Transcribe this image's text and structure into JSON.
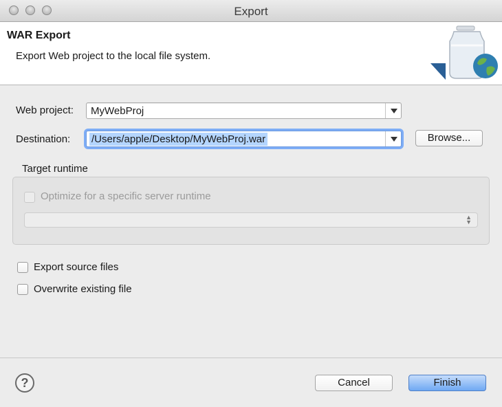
{
  "window": {
    "title": "Export"
  },
  "header": {
    "title": "WAR Export",
    "description": "Export Web project to the local file system."
  },
  "form": {
    "web_project": {
      "label": "Web project:",
      "value": "MyWebProj"
    },
    "destination": {
      "label": "Destination:",
      "value": "/Users/apple/Desktop/MyWebProj.war",
      "browse_label": "Browse..."
    }
  },
  "target_runtime": {
    "group_label": "Target runtime",
    "optimize_label": "Optimize for a specific server runtime",
    "optimize_checked": false,
    "runtime_value": ""
  },
  "options": {
    "export_source": {
      "label": "Export source files",
      "checked": false
    },
    "overwrite": {
      "label": "Overwrite existing file",
      "checked": false
    }
  },
  "footer": {
    "help_icon": "?",
    "cancel_label": "Cancel",
    "finish_label": "Finish"
  },
  "colors": {
    "selection": "#b4d5fe",
    "primary_button": "#6fa8f3",
    "focus_ring": "#7eadf6"
  }
}
